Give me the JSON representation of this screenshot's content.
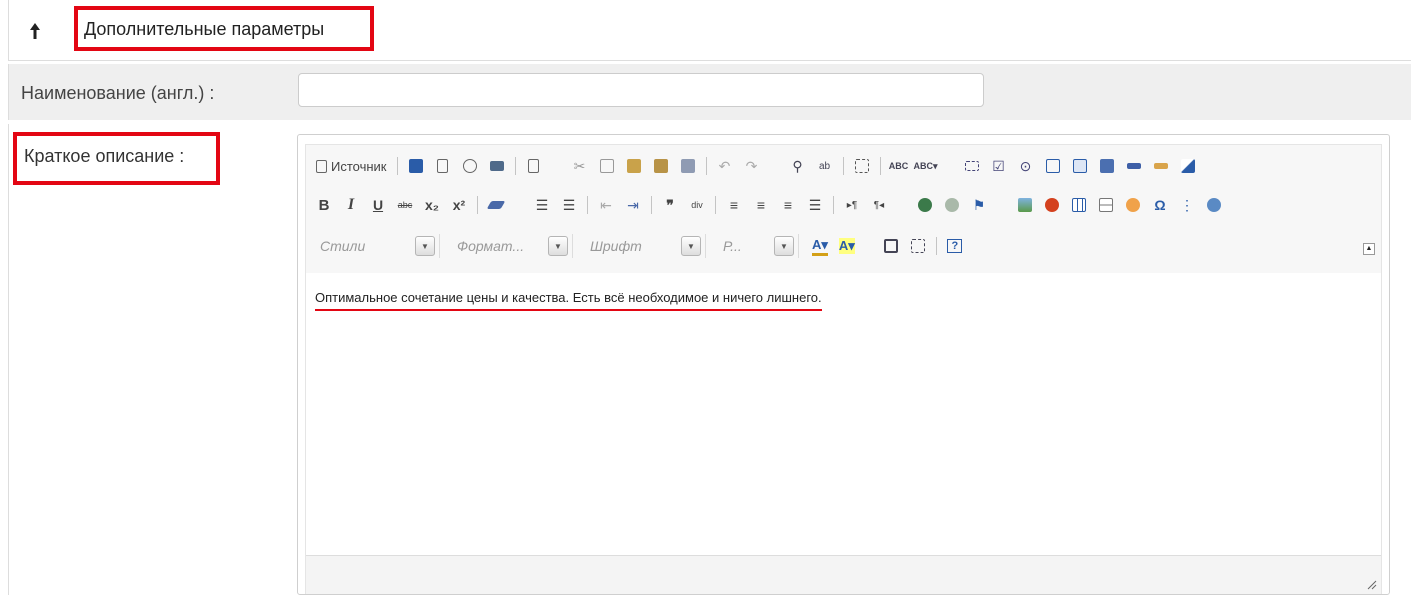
{
  "section": {
    "title": "Дополнительные параметры",
    "arrow_icon": "arrow-up-icon"
  },
  "fields": {
    "name_en": {
      "label": "Наименование (англ.) :",
      "value": "",
      "placeholder": ""
    },
    "short_desc": {
      "label": "Краткое описание :"
    }
  },
  "editor": {
    "toolbar": {
      "source_label": "Источник",
      "combos": {
        "styles": "Стили",
        "format": "Формат...",
        "font": "Шрифт",
        "size": "Р..."
      }
    },
    "content": "Оптимальное сочетание цены и качества. Есть всё необходимое и ничего лишнего."
  },
  "colors": {
    "highlight": "#e30613",
    "toolbar_bg": "#f7f7f7",
    "row_bg": "#efefef"
  }
}
